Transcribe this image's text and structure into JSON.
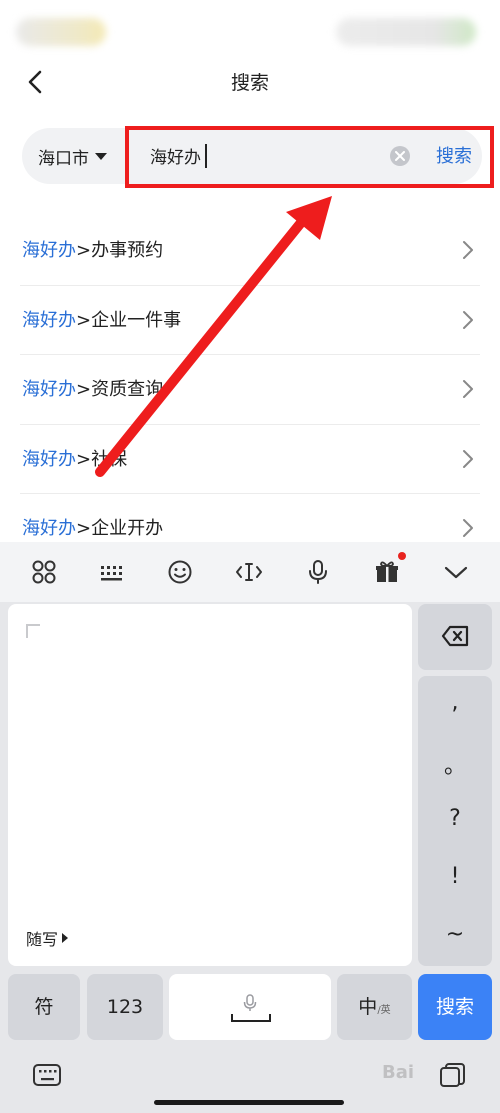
{
  "nav": {
    "title": "搜索"
  },
  "search": {
    "city": "海口市",
    "query": "海好办",
    "button_label": "搜索"
  },
  "suggestions": [
    {
      "keyword": "海好办",
      "rest": ">办事预约"
    },
    {
      "keyword": "海好办",
      "rest": ">企业一件事"
    },
    {
      "keyword": "海好办",
      "rest": ">资质查询"
    },
    {
      "keyword": "海好办",
      "rest": ">社保"
    },
    {
      "keyword": "海好办",
      "rest": ">企业开办"
    }
  ],
  "keyboard": {
    "handwriting_label": "随写",
    "punctuation": [
      ",",
      "。",
      "?",
      "!",
      "~"
    ],
    "keys": {
      "symbol": "符",
      "numbers": "123",
      "lang": "中",
      "lang_sub": "/英",
      "enter": "搜索"
    }
  },
  "watermark": "Bai"
}
